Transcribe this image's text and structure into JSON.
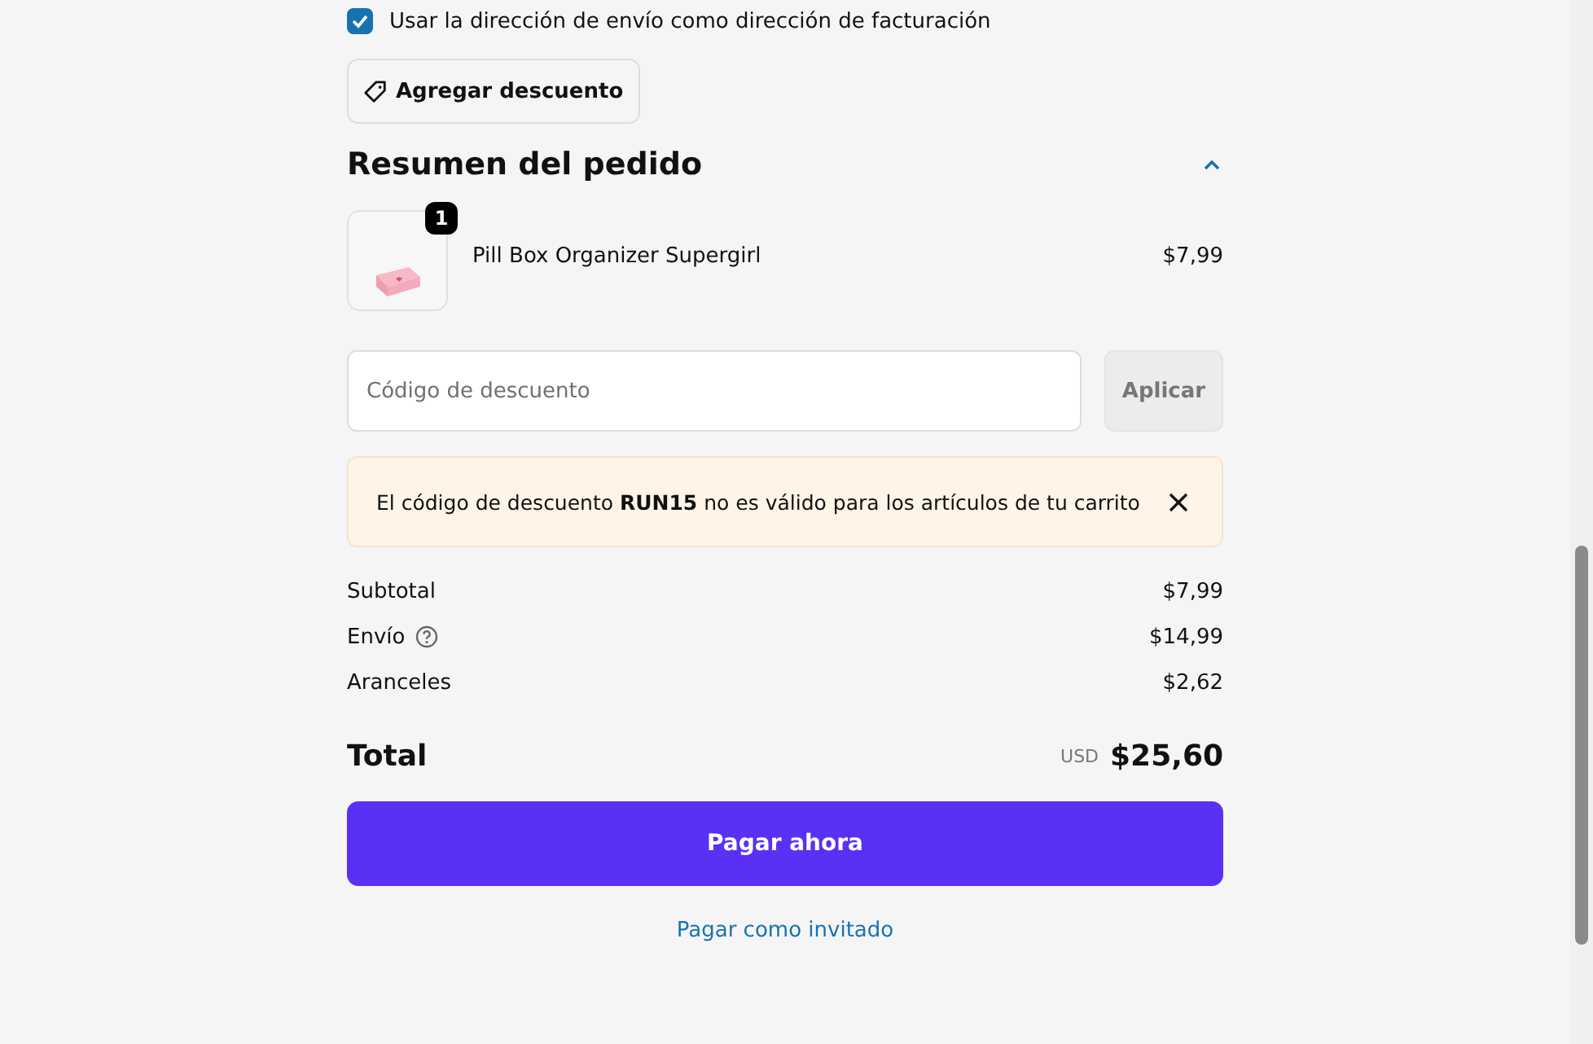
{
  "billing_checkbox": {
    "label": "Usar la dirección de envío como dirección de facturación",
    "checked": true
  },
  "discount_toggle": {
    "label": "Agregar descuento"
  },
  "summary": {
    "title": "Resumen del pedido",
    "expanded": true
  },
  "items": [
    {
      "name": "Pill Box Organizer Supergirl",
      "quantity": "1",
      "price": "$7,99"
    }
  ],
  "discount_field": {
    "placeholder": "Código de descuento",
    "button": "Aplicar"
  },
  "alert": {
    "message": "El código de descuento **RUN15** no es válido para los artículos de tu carrito"
  },
  "costs": [
    {
      "label": "Subtotal",
      "value": "$7,99",
      "help": false
    },
    {
      "label": "Envío",
      "value": "$14,99",
      "help": true
    },
    {
      "label": "Aranceles",
      "value": "$2,62",
      "help": false
    }
  ],
  "total": {
    "label": "Total",
    "currency": "USD",
    "value": "$25,60"
  },
  "pay_button": "Pagar ahora",
  "guest_link": "Pagar como invitado"
}
